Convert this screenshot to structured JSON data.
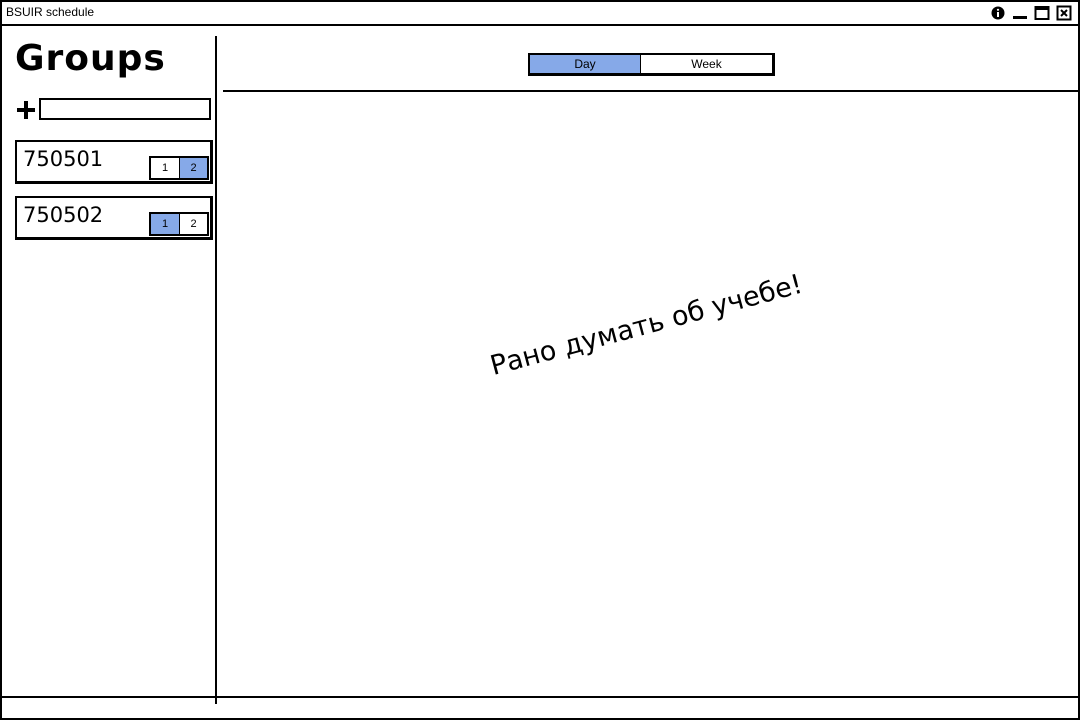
{
  "window": {
    "title": "BSUIR schedule",
    "controls": [
      "info-icon",
      "minimize-icon",
      "maximize-icon",
      "close-icon"
    ]
  },
  "sidebar": {
    "heading": "Groups",
    "add_icon": "plus-icon",
    "add_input_value": "",
    "groups": [
      {
        "name": "750501",
        "subgroups": [
          {
            "label": "1",
            "active": false
          },
          {
            "label": "2",
            "active": true
          }
        ]
      },
      {
        "name": "750502",
        "subgroups": [
          {
            "label": "1",
            "active": true
          },
          {
            "label": "2",
            "active": false
          }
        ]
      }
    ]
  },
  "main": {
    "view_toggle": [
      {
        "label": "Day",
        "active": true
      },
      {
        "label": "Week",
        "active": false
      }
    ],
    "empty_message": "Рано думать об учебе!"
  },
  "colors": {
    "active": "#86a9e8",
    "border": "#000000",
    "background": "#ffffff"
  }
}
